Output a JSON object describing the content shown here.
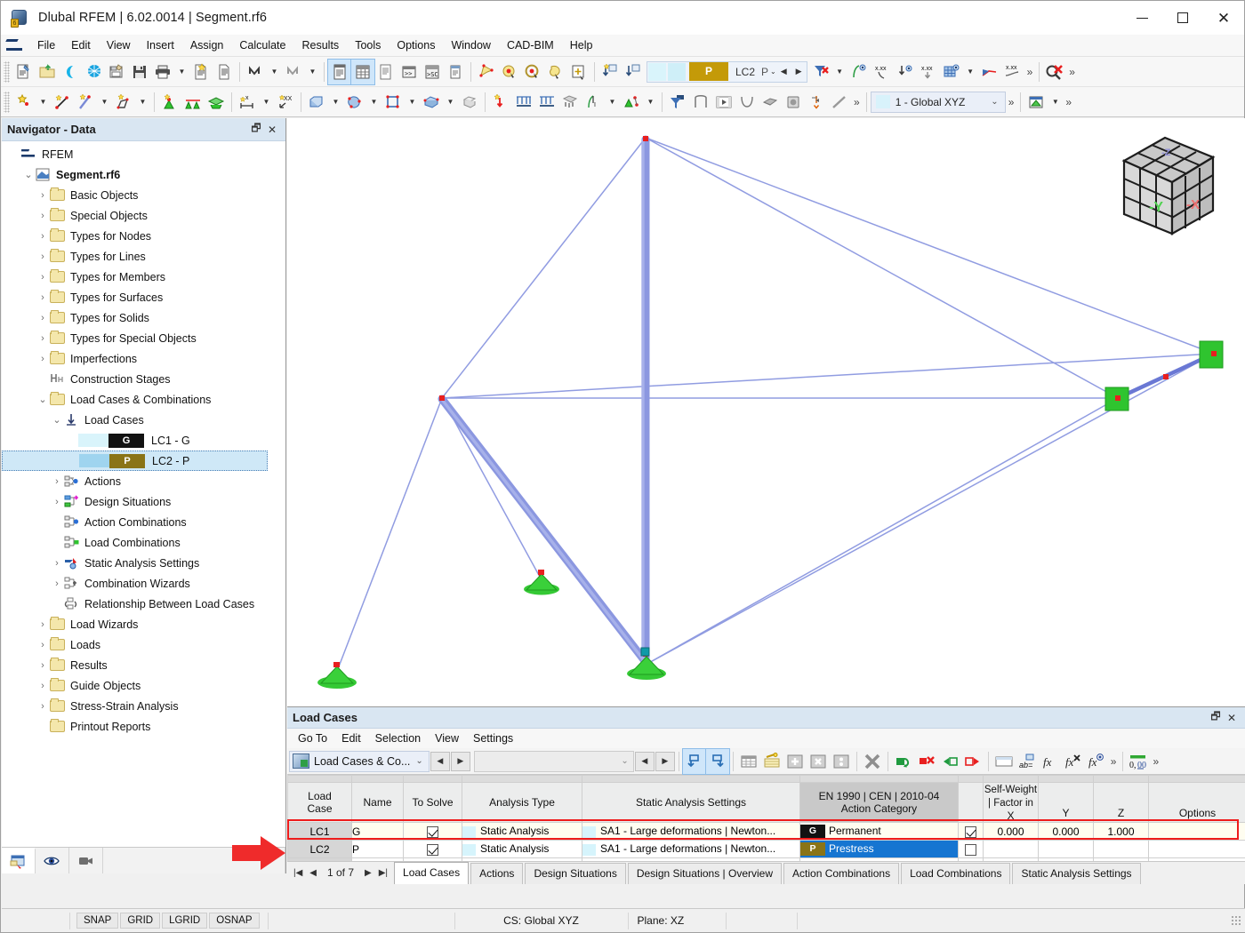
{
  "window": {
    "title": "Dlubal RFEM | 6.02.0014 | Segment.rf6",
    "minimize": "–",
    "maximize": "□",
    "close": "✕"
  },
  "menubar": {
    "items": [
      "File",
      "Edit",
      "View",
      "Insert",
      "Assign",
      "Calculate",
      "Results",
      "Tools",
      "Options",
      "Window",
      "CAD-BIM",
      "Help"
    ]
  },
  "toolbar1": {
    "icons": [
      "new-model-icon",
      "open-folder-icon",
      "dlubal-center-icon",
      "model-cube-icon",
      "save-as-icon",
      "save-icon",
      "print-icon",
      "print-dropdown-caret",
      "new-report-icon",
      "document-icon",
      "undo-icon",
      "undo-caret",
      "redo-icon",
      "redo-caret",
      "navigator-icon",
      "table-icon",
      "table-list-icon",
      "console-icon",
      "script-sc-icon",
      "panel-icon",
      "select-region-icon",
      "select-objects-icon",
      "select-special-icon",
      "select-lasso-icon",
      "select-plus-icon"
    ],
    "lc_combo": {
      "tag": "P",
      "code": "LC2",
      "type": "P"
    },
    "more": "»"
  },
  "toolbar2": {
    "cs_combo": {
      "label": "1 - Global XYZ"
    },
    "more": "»"
  },
  "navigator": {
    "title": "Navigator - Data",
    "restore_icon": "restore-icon",
    "close_icon": "close-icon",
    "tree": [
      {
        "label": "RFEM",
        "depth": 0,
        "arrow": "",
        "icon": "rfem-icon",
        "bold": false
      },
      {
        "label": "Segment.rf6",
        "depth": 1,
        "arrow": "v",
        "icon": "model-icon",
        "bold": true
      },
      {
        "label": "Basic Objects",
        "depth": 2,
        "arrow": ">",
        "icon": "folder",
        "bold": false
      },
      {
        "label": "Special Objects",
        "depth": 2,
        "arrow": ">",
        "icon": "folder",
        "bold": false
      },
      {
        "label": "Types for Nodes",
        "depth": 2,
        "arrow": ">",
        "icon": "folder",
        "bold": false
      },
      {
        "label": "Types for Lines",
        "depth": 2,
        "arrow": ">",
        "icon": "folder",
        "bold": false
      },
      {
        "label": "Types for Members",
        "depth": 2,
        "arrow": ">",
        "icon": "folder",
        "bold": false
      },
      {
        "label": "Types for Surfaces",
        "depth": 2,
        "arrow": ">",
        "icon": "folder",
        "bold": false
      },
      {
        "label": "Types for Solids",
        "depth": 2,
        "arrow": ">",
        "icon": "folder",
        "bold": false
      },
      {
        "label": "Types for Special Objects",
        "depth": 2,
        "arrow": ">",
        "icon": "folder",
        "bold": false
      },
      {
        "label": "Imperfections",
        "depth": 2,
        "arrow": ">",
        "icon": "folder",
        "bold": false
      },
      {
        "label": "Construction Stages",
        "depth": 2,
        "arrow": "",
        "icon": "construction-stages-icon",
        "bold": false
      },
      {
        "label": "Load Cases & Combinations",
        "depth": 2,
        "arrow": "v",
        "icon": "folder",
        "bold": false
      },
      {
        "label": "Load Cases",
        "depth": 3,
        "arrow": "v",
        "icon": "load-cases-icon",
        "bold": false
      },
      {
        "label": "LC1 - G",
        "depth": 4,
        "arrow": "",
        "icon": "tag-g",
        "bold": false
      },
      {
        "label": "LC2 - P",
        "depth": 4,
        "arrow": "",
        "icon": "tag-p",
        "bold": false,
        "selected": true
      },
      {
        "label": "Actions",
        "depth": 3,
        "arrow": ">",
        "icon": "actions-icon",
        "bold": false
      },
      {
        "label": "Design Situations",
        "depth": 3,
        "arrow": ">",
        "icon": "design-situations-icon",
        "bold": false
      },
      {
        "label": "Action Combinations",
        "depth": 3,
        "arrow": "",
        "icon": "action-combinations-icon",
        "bold": false
      },
      {
        "label": "Load Combinations",
        "depth": 3,
        "arrow": "",
        "icon": "load-combinations-icon",
        "bold": false
      },
      {
        "label": "Static Analysis Settings",
        "depth": 3,
        "arrow": ">",
        "icon": "static-analysis-icon",
        "bold": false
      },
      {
        "label": "Combination Wizards",
        "depth": 3,
        "arrow": ">",
        "icon": "combination-wizards-icon",
        "bold": false
      },
      {
        "label": "Relationship Between Load Cases",
        "depth": 3,
        "arrow": "",
        "icon": "relationship-icon",
        "bold": false
      },
      {
        "label": "Load Wizards",
        "depth": 2,
        "arrow": ">",
        "icon": "folder",
        "bold": false
      },
      {
        "label": "Loads",
        "depth": 2,
        "arrow": ">",
        "icon": "folder",
        "bold": false
      },
      {
        "label": "Results",
        "depth": 2,
        "arrow": ">",
        "icon": "folder",
        "bold": false
      },
      {
        "label": "Guide Objects",
        "depth": 2,
        "arrow": ">",
        "icon": "folder",
        "bold": false
      },
      {
        "label": "Stress-Strain Analysis",
        "depth": 2,
        "arrow": ">",
        "icon": "folder",
        "bold": false
      },
      {
        "label": "Printout Reports",
        "depth": 2,
        "arrow": "",
        "icon": "folder",
        "bold": false
      }
    ],
    "bottom_tabs": [
      "data-navigator-icon",
      "display-eye-icon",
      "views-camera-icon"
    ]
  },
  "viewport": {
    "navcube": {
      "face_left": "-Y",
      "face_right": "-X"
    }
  },
  "table_panel": {
    "title": "Load Cases",
    "restore_icon": "restore-icon",
    "close_icon": "close-icon",
    "menu": [
      "Go To",
      "Edit",
      "Selection",
      "View",
      "Settings"
    ],
    "combo_primary": "Load Cases & Co...",
    "combo_secondary": "",
    "headers": {
      "load_case": "Load\nCase",
      "name": "Name",
      "to_solve": "To Solve",
      "analysis_type": "Analysis Type",
      "static_analysis_settings": "Static Analysis Settings",
      "action_category_top": "EN 1990 | CEN | 2010-04",
      "action_category_bottom": "Action Category",
      "self_weight_top": "Self-Weight | Factor in",
      "sw_x": "X",
      "sw_y": "Y",
      "sw_z": "Z",
      "options": "Options"
    },
    "rows": [
      {
        "load_case": "LC1",
        "name": "G",
        "to_solve": true,
        "analysis_type": "Static Analysis",
        "static_analysis_settings": "SA1 - Large deformations | Newton...",
        "action_tag": "G",
        "action_category": "Permanent",
        "sw_active": true,
        "sw_x": "0.000",
        "sw_y": "0.000",
        "sw_z": "1.000",
        "options": ""
      },
      {
        "load_case": "LC2",
        "name": "P",
        "to_solve": true,
        "analysis_type": "Static Analysis",
        "static_analysis_settings": "SA1 - Large deformations | Newton...",
        "action_tag": "P",
        "action_category": "Prestress",
        "sw_active": false,
        "sw_x": "",
        "sw_y": "",
        "sw_z": "",
        "options": "",
        "highlighted": true
      }
    ],
    "page_label": "1 of 7",
    "tabs": [
      {
        "label": "Load Cases",
        "active": true
      },
      {
        "label": "Actions",
        "active": false
      },
      {
        "label": "Design Situations",
        "active": false
      },
      {
        "label": "Design Situations | Overview",
        "active": false
      },
      {
        "label": "Action Combinations",
        "active": false
      },
      {
        "label": "Load Combinations",
        "active": false
      },
      {
        "label": "Static Analysis Settings",
        "active": false
      }
    ]
  },
  "statusbar": {
    "toggles": [
      "SNAP",
      "GRID",
      "LGRID",
      "OSNAP"
    ],
    "cs": "CS: Global XYZ",
    "plane": "Plane: XZ"
  },
  "colors": {
    "accent_blue": "#1675d1",
    "highlight_red": "#ee1c1c",
    "tag_permanent": "#121212",
    "tag_prestress": "#8a7417",
    "member_blue": "#8b97e0",
    "support_green": "#2fc42f",
    "node_red": "#e81f1f"
  }
}
